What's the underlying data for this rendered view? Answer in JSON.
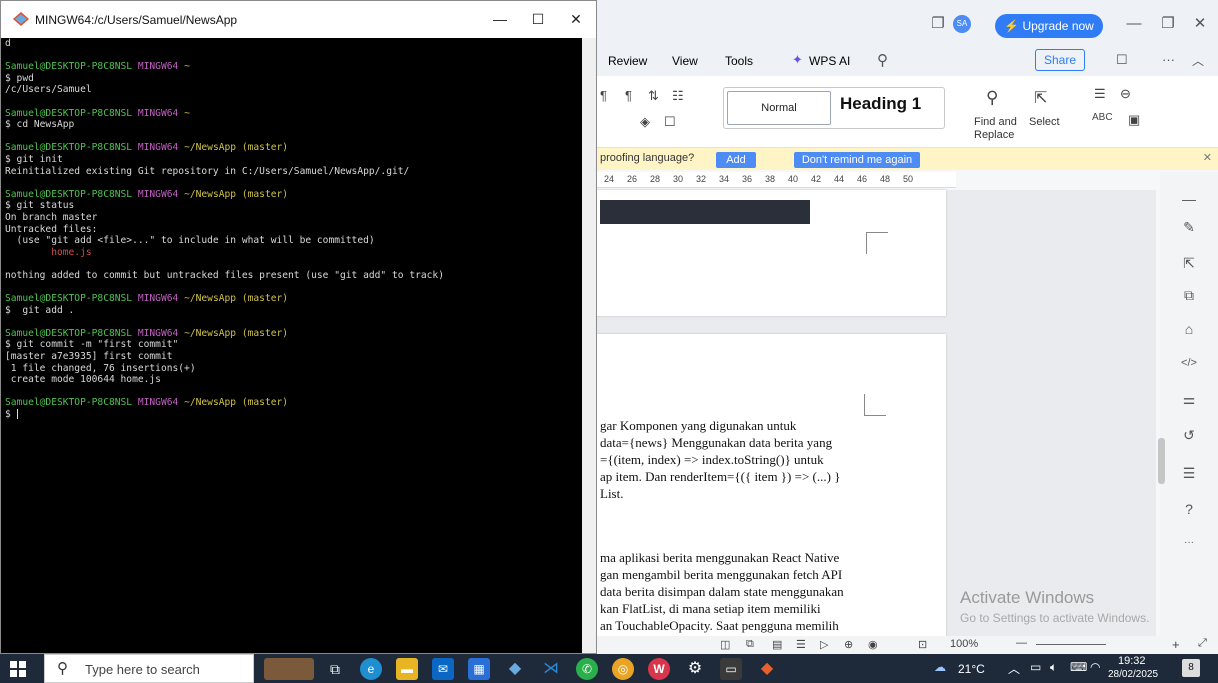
{
  "terminal": {
    "title": "MINGW64:/c/Users/Samuel/NewsApp",
    "controls": {
      "minimize": "—",
      "maximize": "☐",
      "close": "✕"
    },
    "lines": [
      {
        "parts": [
          {
            "t": "d",
            "c": ""
          }
        ]
      },
      {
        "parts": []
      },
      {
        "parts": [
          {
            "t": "Samuel@DESKTOP-P8C8NSL ",
            "c": "t-green"
          },
          {
            "t": "MINGW64 ",
            "c": "t-purple"
          },
          {
            "t": "~",
            "c": "t-yellow"
          }
        ]
      },
      {
        "parts": [
          {
            "t": "$ pwd",
            "c": ""
          }
        ]
      },
      {
        "parts": [
          {
            "t": "/c/Users/Samuel",
            "c": ""
          }
        ]
      },
      {
        "parts": []
      },
      {
        "parts": [
          {
            "t": "Samuel@DESKTOP-P8C8NSL ",
            "c": "t-green"
          },
          {
            "t": "MINGW64 ",
            "c": "t-purple"
          },
          {
            "t": "~",
            "c": "t-yellow"
          }
        ]
      },
      {
        "parts": [
          {
            "t": "$ cd NewsApp",
            "c": ""
          }
        ]
      },
      {
        "parts": []
      },
      {
        "parts": [
          {
            "t": "Samuel@DESKTOP-P8C8NSL ",
            "c": "t-green"
          },
          {
            "t": "MINGW64 ",
            "c": "t-purple"
          },
          {
            "t": "~/NewsApp (master)",
            "c": "t-yellow"
          }
        ]
      },
      {
        "parts": [
          {
            "t": "$ git init",
            "c": ""
          }
        ]
      },
      {
        "parts": [
          {
            "t": "Reinitialized existing Git repository in C:/Users/Samuel/NewsApp/.git/",
            "c": ""
          }
        ]
      },
      {
        "parts": []
      },
      {
        "parts": [
          {
            "t": "Samuel@DESKTOP-P8C8NSL ",
            "c": "t-green"
          },
          {
            "t": "MINGW64 ",
            "c": "t-purple"
          },
          {
            "t": "~/NewsApp (master)",
            "c": "t-yellow"
          }
        ]
      },
      {
        "parts": [
          {
            "t": "$ git status",
            "c": ""
          }
        ]
      },
      {
        "parts": [
          {
            "t": "On branch master",
            "c": ""
          }
        ]
      },
      {
        "parts": [
          {
            "t": "Untracked files:",
            "c": ""
          }
        ]
      },
      {
        "parts": [
          {
            "t": "  (use \"git add <file>...\" to include in what will be committed)",
            "c": ""
          }
        ]
      },
      {
        "parts": [
          {
            "t": "        home.js",
            "c": "t-red"
          }
        ]
      },
      {
        "parts": []
      },
      {
        "parts": [
          {
            "t": "nothing added to commit but untracked files present (use \"git add\" to track)",
            "c": ""
          }
        ]
      },
      {
        "parts": []
      },
      {
        "parts": [
          {
            "t": "Samuel@DESKTOP-P8C8NSL ",
            "c": "t-green"
          },
          {
            "t": "MINGW64 ",
            "c": "t-purple"
          },
          {
            "t": "~/NewsApp (master)",
            "c": "t-yellow"
          }
        ]
      },
      {
        "parts": [
          {
            "t": "$  git add .",
            "c": ""
          }
        ]
      },
      {
        "parts": []
      },
      {
        "parts": [
          {
            "t": "Samuel@DESKTOP-P8C8NSL ",
            "c": "t-green"
          },
          {
            "t": "MINGW64 ",
            "c": "t-purple"
          },
          {
            "t": "~/NewsApp (master)",
            "c": "t-yellow"
          }
        ]
      },
      {
        "parts": [
          {
            "t": "$ git commit -m \"first commit\"",
            "c": ""
          }
        ]
      },
      {
        "parts": [
          {
            "t": "[master a7e3935] first commit",
            "c": ""
          }
        ]
      },
      {
        "parts": [
          {
            "t": " 1 file changed, 76 insertions(+)",
            "c": ""
          }
        ]
      },
      {
        "parts": [
          {
            "t": " create mode 100644 home.js",
            "c": ""
          }
        ]
      },
      {
        "parts": []
      },
      {
        "parts": [
          {
            "t": "Samuel@DESKTOP-P8C8NSL ",
            "c": "t-green"
          },
          {
            "t": "MINGW64 ",
            "c": "t-purple"
          },
          {
            "t": "~/NewsApp (master)",
            "c": "t-yellow"
          }
        ]
      },
      {
        "parts": [
          {
            "t": "$ ",
            "c": ""
          }
        ],
        "cursor": true
      }
    ]
  },
  "wps": {
    "upgrade_label": "⚡ Upgrade now",
    "avatar_initials": "SA",
    "menu": [
      "Review",
      "View",
      "Tools",
      "WPS AI"
    ],
    "share_label": "Share",
    "style_normal": "Normal",
    "style_heading": "Heading 1",
    "find_replace": "Find and Replace",
    "select_label": "Select",
    "notify_text": "proofing language?",
    "add_label": "Add",
    "remind_label": "Don't remind me again",
    "ruler_numbers": [
      "24",
      "26",
      "28",
      "30",
      "32",
      "34",
      "36",
      "38",
      "40",
      "42",
      "44",
      "46",
      "48",
      "50"
    ],
    "doc_lines": [
      "gar Komponen yang digunakan untuk",
      " data={news}  Menggunakan data berita yang",
      "={(item, index) => index.toString()} untuk",
      "ap item. Dan renderItem={({ item }) => (...) }",
      "List.",
      "ma aplikasi berita menggunakan React Native",
      "gan mengambil berita menggunakan fetch API",
      "data berita disimpan dalam state menggunakan",
      "kan FlatList, di mana setiap item memiliki",
      "an TouchableOpacity. Saat pengguna memilih"
    ],
    "watermark_title": "Activate Windows",
    "watermark_sub": "Go to Settings to activate Windows.",
    "zoom": "100%"
  },
  "taskbar": {
    "search_placeholder": "Type here to search",
    "weather": "21°C",
    "time": "19:32",
    "date": "28/02/2025",
    "notification_count": "8"
  }
}
